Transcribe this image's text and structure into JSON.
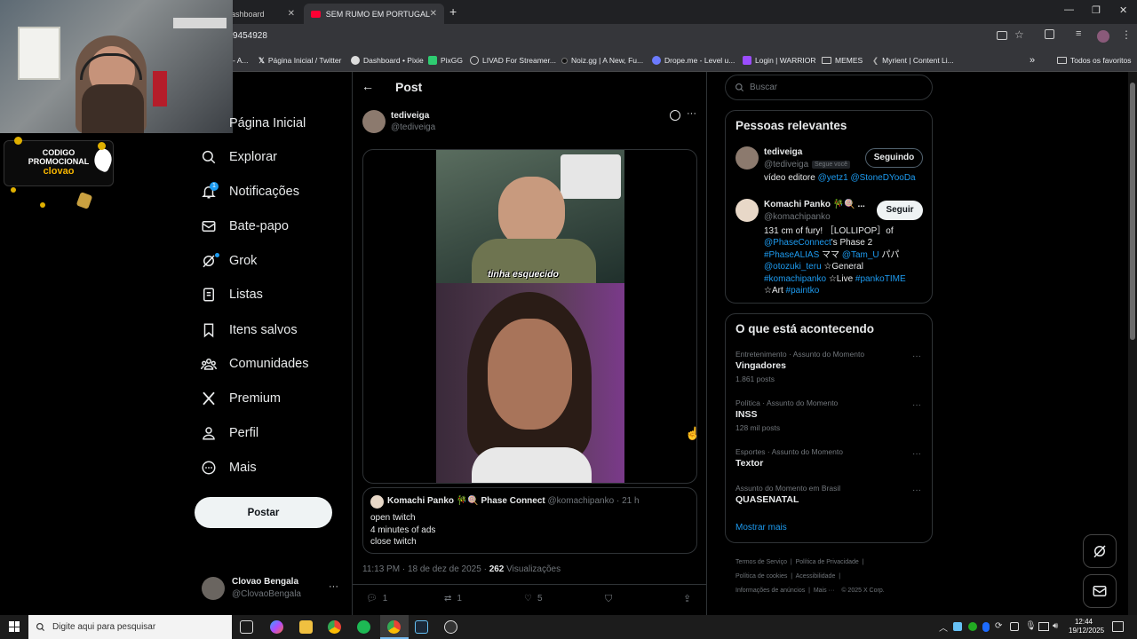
{
  "browser": {
    "tabs": [
      {
        "label": "ashboard"
      },
      {
        "label": "SEM RUMO EM PORTUGAL - Yo"
      }
    ],
    "address": "9454928",
    "bookmarks": [
      {
        "label": "- A..."
      },
      {
        "label": "Página Inicial / Twitter"
      },
      {
        "label": "Dashboard • Pixie"
      },
      {
        "label": "PixGG"
      },
      {
        "label": "LIVAD For Streamer..."
      },
      {
        "label": "Noiz.gg | A New, Fu..."
      },
      {
        "label": "Drope.me - Level u..."
      },
      {
        "label": "Login | WARRIOR"
      },
      {
        "label": "MEMES"
      },
      {
        "label": "Myrient | Content Li..."
      }
    ],
    "all_bookmarks": "Todos os favoritos"
  },
  "overlay": {
    "promo_line1": "CODIGO",
    "promo_line2": "PROMOCIONAL",
    "promo_code": "clovao"
  },
  "nav": {
    "items": [
      {
        "label": "Página Inicial",
        "icon": "home-icon"
      },
      {
        "label": "Explorar",
        "icon": "search-icon"
      },
      {
        "label": "Notificações",
        "icon": "bell-icon",
        "badge": "1"
      },
      {
        "label": "Bate-papo",
        "icon": "mail-icon"
      },
      {
        "label": "Grok",
        "icon": "grok-icon"
      },
      {
        "label": "Listas",
        "icon": "list-icon"
      },
      {
        "label": "Itens salvos",
        "icon": "bookmark-icon"
      },
      {
        "label": "Comunidades",
        "icon": "communities-icon"
      },
      {
        "label": "Premium",
        "icon": "x-logo-icon"
      },
      {
        "label": "Perfil",
        "icon": "person-icon"
      },
      {
        "label": "Mais",
        "icon": "more-circle-icon"
      }
    ],
    "post_button": "Postar",
    "account": {
      "name": "Clovao Bengala",
      "handle": "@ClovaoBengala"
    }
  },
  "post": {
    "header_title": "Post",
    "author_name": "tediveiga",
    "author_handle": "@tediveiga",
    "video_caption": "tinha esquecido",
    "quote": {
      "author": "Komachi Panko",
      "author_suffix": "Phase Connect",
      "handle": "@komachipanko",
      "time": "21 h",
      "lines": [
        "open twitch",
        "4 minutes of ads",
        "close twitch"
      ]
    },
    "meta_time": "11:13 PM · 18 de dez de 2025 · ",
    "views_count": "262",
    "views_label": " Visualizações",
    "actions": {
      "replies": "1",
      "reposts": "1",
      "likes": "5"
    }
  },
  "sidebar": {
    "search_placeholder": "Buscar",
    "relevant_title": "Pessoas relevantes",
    "people": [
      {
        "name": "tediveiga",
        "handle": "@tediveiga",
        "follows_you": "Segue você",
        "button": "Seguindo",
        "bio_prefix": "vídeo editore ",
        "bio_link1": "@yetz1",
        "bio_link2": "@StoneDYooDa"
      },
      {
        "name": "Komachi Panko 🎋🍭 ...",
        "handle": "@komachipanko",
        "button": "Seguir",
        "bio_l1": "131 cm of fury! ［LOLLIPOP］of",
        "bio_l2_link": "@PhaseConnect",
        "bio_l2_rest": "'s Phase 2",
        "bio_l3_link1": "#PhaseALIAS",
        "bio_l3_mid": " ママ ",
        "bio_l3_link2": "@Tam_U",
        "bio_l3_rest": " パパ",
        "bio_l4_link": "@otozuki_teru",
        "bio_l4_rest": " ☆General",
        "bio_l5_link": "#komachipanko",
        "bio_l5_mid": " ☆Live ",
        "bio_l5_link2": "#pankoTIME",
        "bio_l6_pre": "☆Art ",
        "bio_l6_link": "#paintko"
      }
    ],
    "trends_title": "O que está acontecendo",
    "trends": [
      {
        "context": "Entretenimento · Assunto do Momento",
        "name": "Vingadores",
        "posts": "1.861 posts"
      },
      {
        "context": "Política · Assunto do Momento",
        "name": "INSS",
        "posts": "128 mil posts"
      },
      {
        "context": "Esportes · Assunto do Momento",
        "name": "Textor",
        "posts": ""
      },
      {
        "context": "Assunto do Momento em Brasil",
        "name": "QUASENATAL",
        "posts": ""
      }
    ],
    "show_more": "Mostrar mais",
    "footer": [
      "Termos de Serviço",
      "Política de Privacidade",
      "Política de cookies",
      "Acessibilidade",
      "Informações de anúncios",
      "Mais ···",
      "© 2025 X Corp."
    ]
  },
  "taskbar": {
    "search_placeholder": "Digite aqui para pesquisar",
    "time": "12:44",
    "date": "19/12/2025"
  },
  "colors": {
    "accent": "#1d9bf0",
    "bg": "#000000",
    "border": "#2f3336",
    "muted": "#71767b"
  }
}
